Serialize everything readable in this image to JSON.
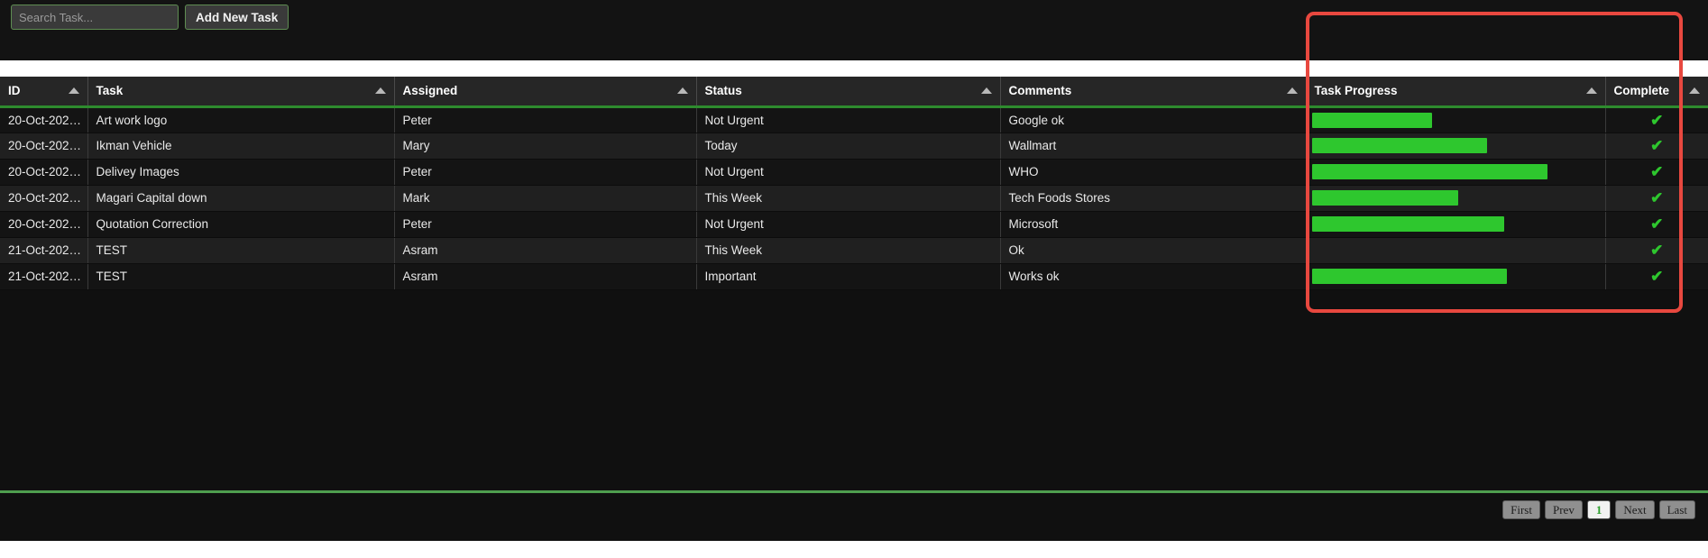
{
  "toolbar": {
    "search_placeholder": "Search Task...",
    "search_value": "",
    "add_button_label": "Add New Task"
  },
  "table": {
    "columns": [
      {
        "label": "ID",
        "key": "id",
        "sort": "asc"
      },
      {
        "label": "Task",
        "key": "task",
        "sort": "asc"
      },
      {
        "label": "Assigned",
        "key": "assigned",
        "sort": "asc"
      },
      {
        "label": "Status",
        "key": "status",
        "sort": "asc"
      },
      {
        "label": "Comments",
        "key": "comments",
        "sort": "asc"
      },
      {
        "label": "Task Progress",
        "key": "progress",
        "sort": "asc"
      },
      {
        "label": "Complete",
        "key": "complete",
        "sort": "asc"
      }
    ],
    "rows": [
      {
        "id": "20-Oct-202…",
        "task": "Art work logo",
        "assigned": "Peter",
        "status": "Not Urgent",
        "comments": "Google ok",
        "progress_percent": 42,
        "complete": true
      },
      {
        "id": "20-Oct-202…",
        "task": "Ikman Vehicle",
        "assigned": "Mary",
        "status": "Today",
        "comments": "Wallmart",
        "progress_percent": 61,
        "complete": true
      },
      {
        "id": "20-Oct-202…",
        "task": "Delivey Images",
        "assigned": "Peter",
        "status": "Not Urgent",
        "comments": "WHO",
        "progress_percent": 82,
        "complete": true
      },
      {
        "id": "20-Oct-202…",
        "task": "Magari Capital down",
        "assigned": "Mark",
        "status": "This Week",
        "comments": "Tech Foods Stores",
        "progress_percent": 51,
        "complete": true
      },
      {
        "id": "20-Oct-202…",
        "task": "Quotation Correction",
        "assigned": "Peter",
        "status": "Not Urgent",
        "comments": "Microsoft",
        "progress_percent": 67,
        "complete": true
      },
      {
        "id": "21-Oct-202…",
        "task": "TEST",
        "assigned": "Asram",
        "status": "This Week",
        "comments": "Ok",
        "progress_percent": 0,
        "complete": true
      },
      {
        "id": "21-Oct-202…",
        "task": "TEST",
        "assigned": "Asram",
        "status": "Important",
        "comments": "Works ok",
        "progress_percent": 68,
        "complete": true
      }
    ],
    "check_glyph": "✔"
  },
  "pagination": {
    "first_label": "First",
    "prev_label": "Prev",
    "current_page": "1",
    "next_label": "Next",
    "last_label": "Last"
  },
  "colors": {
    "accent_green": "#2ec72e",
    "header_rule_green": "#2e8b2e",
    "highlight_red": "#e8483f",
    "page_background": "#101010",
    "header_background": "#262626"
  },
  "annotation": {
    "highlight_target": "Task Progress"
  }
}
